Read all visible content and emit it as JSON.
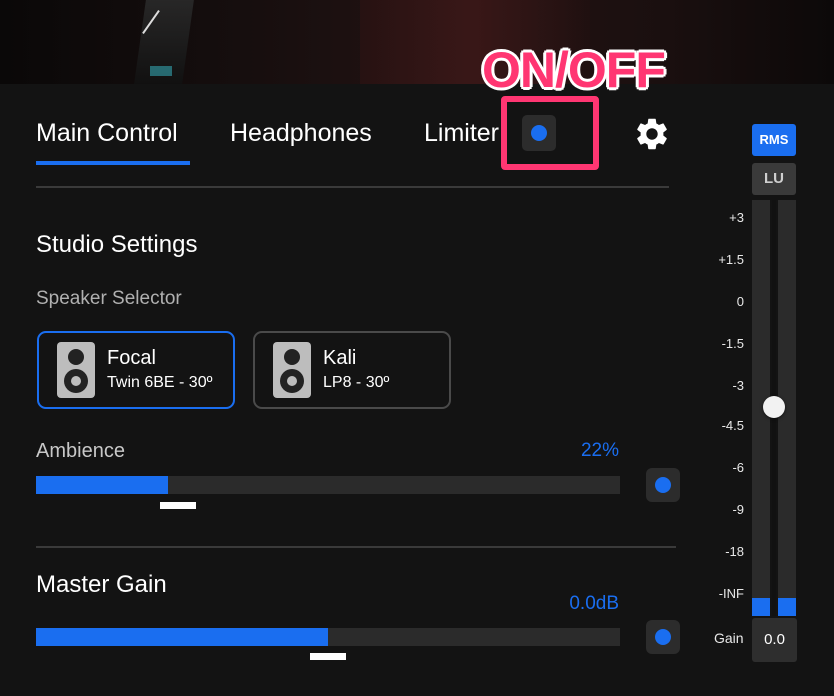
{
  "tabs": [
    {
      "label": "Main Control",
      "active": true
    },
    {
      "label": "Headphones",
      "active": false
    },
    {
      "label": "Limiter",
      "active": false
    }
  ],
  "limiter_toggle": {
    "state": "on",
    "color": "#1a6ef0"
  },
  "annotation": {
    "label": "ON/OFF",
    "color": "#ff3672"
  },
  "settings_icon": "gear-icon",
  "studio": {
    "title": "Studio Settings",
    "speaker_selector_label": "Speaker Selector",
    "speakers": [
      {
        "name": "Focal",
        "model": "Twin 6BE - 30º",
        "selected": true,
        "icon": "speaker-icon"
      },
      {
        "name": "Kali",
        "model": "LP8 - 30º",
        "selected": false,
        "icon": "speaker-icon"
      }
    ]
  },
  "ambience": {
    "label": "Ambience",
    "value_text": "22%",
    "fill_fraction": 0.226
  },
  "master_gain": {
    "label": "Master Gain",
    "value_text": "0.0dB",
    "fill_fraction": 0.5
  },
  "meter": {
    "modes": [
      "RMS",
      "LU"
    ],
    "active_mode": "RMS",
    "scale": [
      "+3",
      "+1.5",
      "0",
      "-1.5",
      "-3",
      "-4.5",
      "-6",
      "-9",
      "-18",
      "-INF"
    ],
    "gain_label": "Gain",
    "gain_value": "0.0"
  },
  "colors": {
    "accent": "#1a6ef0",
    "background": "#131313",
    "annotation": "#ff3672"
  }
}
